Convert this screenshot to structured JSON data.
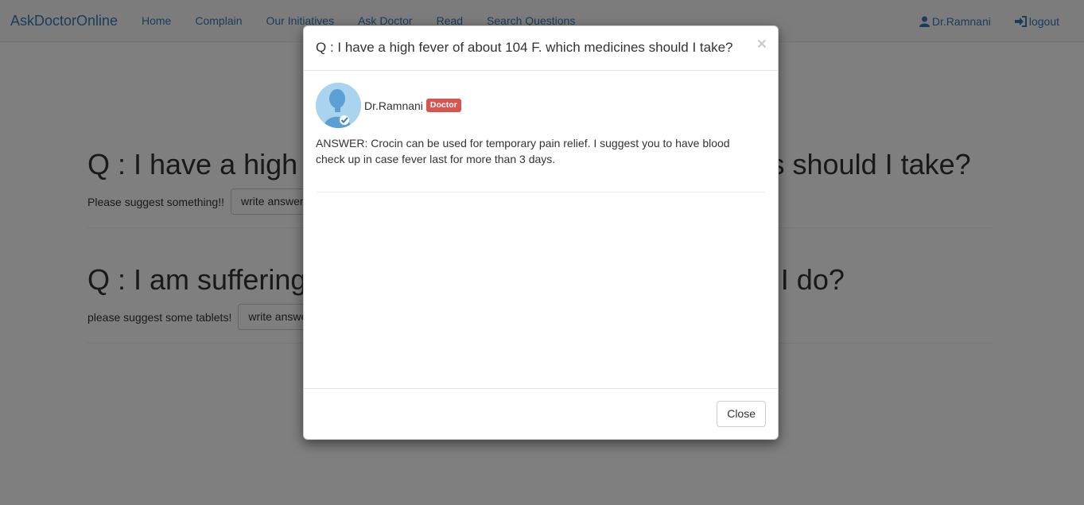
{
  "nav": {
    "brand": "AskDoctorOnline",
    "links": [
      "Home",
      "Complain",
      "Our Initiatives",
      "Ask Doctor",
      "Read",
      "Search Questions"
    ],
    "user": "Dr.Ramnani",
    "logout": "logout",
    "icons": {
      "user": "user-icon",
      "logout": "log-in-icon"
    }
  },
  "questions": [
    {
      "title": "Q : I have a high fever of about 104 F. which medicines should I take?",
      "body": "Please suggest something!!",
      "button": "write answer"
    },
    {
      "title": "Q : I am suffering from a cough and cold. What should I do?",
      "body": "please suggest some tablets!",
      "button": "write answer"
    }
  ],
  "modal": {
    "title": "Q : I have a high fever of about 104 F. which medicines should I take?",
    "close_symbol": "×",
    "doctor_name": "Dr.Ramnani",
    "badge": "Doctor",
    "answer": "ANSWER: Crocin can be used for temporary pain relief. I suggest you to have blood check up in case fever last for more than 3 days.",
    "close_button": "Close"
  },
  "colors": {
    "link": "#337ab7",
    "badge": "#d9534f",
    "avatar": "#a9d3ef"
  }
}
